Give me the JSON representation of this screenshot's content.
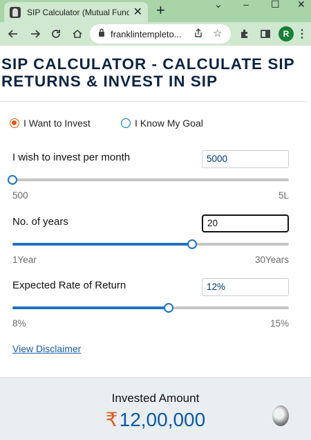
{
  "browser": {
    "tab_title": "SIP Calculator (Mutual Fund S",
    "url": "franklintempleto..."
  },
  "avatar_letter": "R",
  "page": {
    "title_line1": "SIP CALCULATOR - CALCULATE SIP",
    "title_line2": "RETURNS & INVEST IN SIP"
  },
  "mode": {
    "options": [
      "I Want to Invest",
      "I Know My Goal"
    ],
    "selected": "I Want to Invest"
  },
  "fields": {
    "monthly": {
      "label": "I wish to invest per month",
      "value": "5000",
      "min_label": "500",
      "max_label": "5L",
      "fraction": 0.0
    },
    "years": {
      "label": "No. of years",
      "value": "20",
      "min_label": "1Year",
      "max_label": "30Years",
      "fraction": 0.65
    },
    "rate": {
      "label": "Expected Rate of Return",
      "value": "12%",
      "min_label": "8%",
      "max_label": "15%",
      "fraction": 0.565
    }
  },
  "disclaimer_link": "View Disclaimer",
  "result": {
    "label": "Invested Amount",
    "currency": "₹",
    "value": "12,00,000"
  },
  "colors": {
    "accent": "#1e73be",
    "currency": "#e05a1c",
    "title": "#0c2340"
  }
}
